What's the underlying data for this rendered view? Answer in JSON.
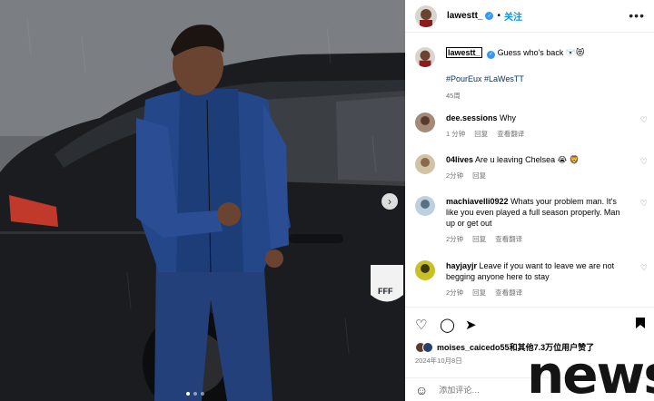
{
  "post": {
    "username": "lawestt_",
    "follow_label": "关注",
    "more_icon": "more-icon",
    "caption_user": "lawestt_",
    "caption_text": "Guess who's back 🐻‍❄️😻",
    "hashtags": "#PourEux #LaWesTT",
    "caption_time": "45周",
    "likes_users": "moises_caicedo55",
    "likes_suffix": "和其他7.3万位用户赞了",
    "date": "2024年10月8日",
    "add_comment_placeholder": "添加评论…"
  },
  "comments": [
    {
      "user": "dee.sessions",
      "text": "Why",
      "time": "1 分钟",
      "reply": "回复",
      "translate": "查看翻译"
    },
    {
      "user": "04lives",
      "text": "Are u leaving Chelsea 😭 🦁",
      "time": "2分钟",
      "reply": "回复"
    },
    {
      "user": "machiavelli0922",
      "text": "Whats your problem man. It's like you even played a full season properly. Man up or get out",
      "time": "2分钟",
      "reply": "回复",
      "translate": "查看翻译"
    },
    {
      "user": "hayjayjr",
      "text": "Leave if you want to leave we are not begging anyone here to stay",
      "time": "2分钟",
      "reply": "回复",
      "translate": "查看翻译"
    }
  ],
  "watermark": "news",
  "icons": [
    "verified-badge-icon",
    "heart-icon",
    "comment-icon",
    "share-icon",
    "bookmark-icon",
    "emoji-icon",
    "next-arrow-icon"
  ],
  "colors": {
    "link": "#0095f6",
    "hashtag": "#00376b",
    "verified": "#3897f0",
    "meta": "#737373"
  }
}
